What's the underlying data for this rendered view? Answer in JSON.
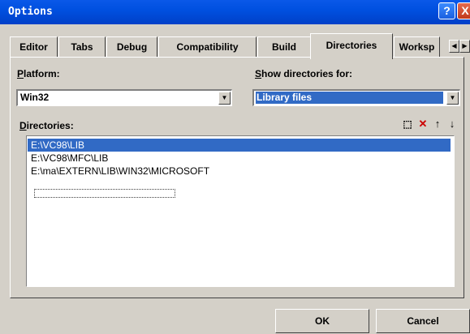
{
  "window": {
    "title": "Options",
    "help_label": "?",
    "close_label": "X"
  },
  "tabs": [
    {
      "label": "Editor"
    },
    {
      "label": "Tabs"
    },
    {
      "label": "Debug"
    },
    {
      "label": "Compatibility"
    },
    {
      "label": "Build"
    },
    {
      "label": "Directories",
      "selected": true
    },
    {
      "label": "Worksp"
    }
  ],
  "tab_scroll": {
    "left": "◀",
    "right": "▶"
  },
  "platform": {
    "label_u": "P",
    "label_rest": "latform:",
    "value": "Win32"
  },
  "show_for": {
    "label_u": "S",
    "label_rest": "how directories for:",
    "value": "Library files"
  },
  "directories": {
    "label_u": "D",
    "label_rest": "irectories:",
    "items": [
      {
        "path": "E:\\VC98\\LIB",
        "selected": true
      },
      {
        "path": "E:\\VC98\\MFC\\LIB",
        "selected": false
      },
      {
        "path": "E:\\ma\\EXTERN\\LIB\\WIN32\\MICROSOFT",
        "selected": false
      }
    ],
    "toolbar": {
      "new": "⬚",
      "delete": "✕",
      "move_up": "↑",
      "move_down": "↓"
    }
  },
  "buttons": {
    "ok": "OK",
    "cancel": "Cancel"
  },
  "colors": {
    "title_bar": "#0050e0",
    "selection": "#316ac5",
    "dialog_face": "#d4d0c8",
    "delete_icon": "#cc0000"
  },
  "dropdown_glyph": "▼"
}
